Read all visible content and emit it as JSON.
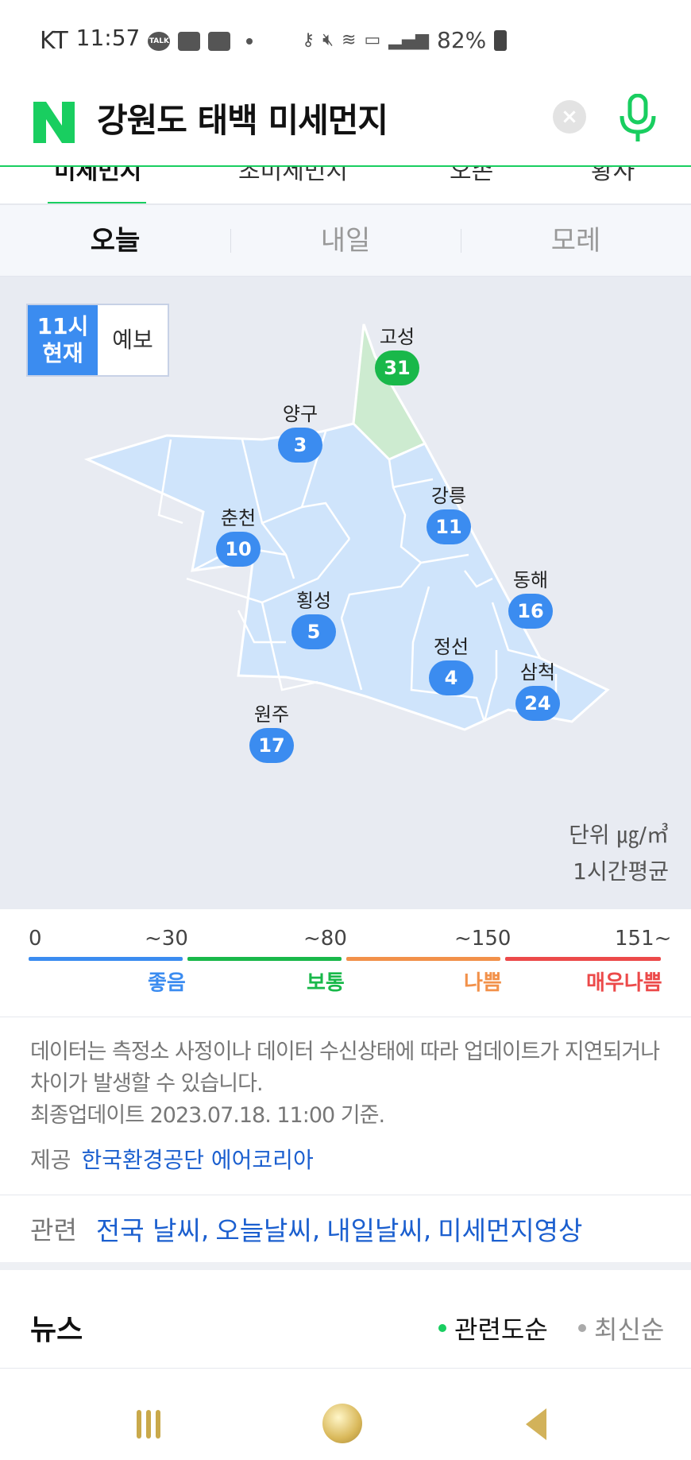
{
  "status_bar": {
    "carrier": "KT",
    "time": "11:57",
    "talk_icon_text": "TALK",
    "battery": "82%"
  },
  "search": {
    "query": "강원도 태백 미세먼지",
    "clear_icon": "×"
  },
  "tabs": [
    "미세먼지",
    "초미세먼지",
    "오존",
    "황사"
  ],
  "day_tabs": {
    "today": "오늘",
    "tomorrow": "내일",
    "day_after": "모레"
  },
  "map": {
    "toggle_current": "11시\n현재",
    "toggle_forecast": "예보",
    "regions": [
      {
        "name": "고성",
        "value": "31",
        "level": "normal"
      },
      {
        "name": "양구",
        "value": "3",
        "level": "good"
      },
      {
        "name": "강릉",
        "value": "11",
        "level": "good"
      },
      {
        "name": "춘천",
        "value": "10",
        "level": "good"
      },
      {
        "name": "동해",
        "value": "16",
        "level": "good"
      },
      {
        "name": "횡성",
        "value": "5",
        "level": "good"
      },
      {
        "name": "정선",
        "value": "4",
        "level": "good"
      },
      {
        "name": "삼척",
        "value": "24",
        "level": "good"
      },
      {
        "name": "원주",
        "value": "17",
        "level": "good"
      }
    ],
    "unit": "단위 ㎍/㎥",
    "average": "1시간평균"
  },
  "scale": {
    "start": "0",
    "segments": [
      {
        "limit": "~30",
        "label": "좋음",
        "color": "#3b8cf0"
      },
      {
        "limit": "~80",
        "label": "보통",
        "color": "#19b84a"
      },
      {
        "limit": "~150",
        "label": "나쁨",
        "color": "#f2914a"
      },
      {
        "limit": "151~",
        "label": "매우나쁨",
        "color": "#ec4a4a"
      }
    ]
  },
  "notice": {
    "line1": "데이터는 측정소 사정이나 데이터 수신상태에 따라 업데이트가 지연되거나",
    "line2": "차이가 발생할 수 있습니다.",
    "line3": "최종업데이트 2023.07.18. 11:00 기준.",
    "provider_label": "제공",
    "provider_link": "한국환경공단 에어코리아"
  },
  "related": {
    "label": "관련",
    "links": [
      "전국 날씨",
      "오늘날씨",
      "내일날씨",
      "미세먼지영상"
    ]
  },
  "news": {
    "title": "뉴스",
    "sort_relevance": "관련도순",
    "sort_latest": "최신순"
  },
  "colors": {
    "accent_green": "#19ce60",
    "good_blue": "#3b8cf0",
    "normal_green": "#19b84a",
    "region_fill": "#cfe4fb",
    "link_blue": "#1b5fcf"
  }
}
